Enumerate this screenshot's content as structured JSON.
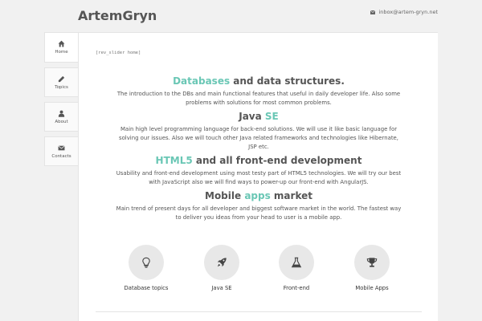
{
  "site": {
    "title": "ArtemGryn",
    "email": "inbox@artem-gryn.net"
  },
  "sidebar": {
    "items": [
      {
        "label": "Home",
        "icon": "home-icon",
        "active": true
      },
      {
        "label": "Topics",
        "icon": "pencil-icon",
        "active": false
      },
      {
        "label": "About",
        "icon": "user-icon",
        "active": false
      },
      {
        "label": "Contacts",
        "icon": "envelope-icon",
        "active": false
      }
    ]
  },
  "main": {
    "slider_shortcode": "[rev_slider home]",
    "sections": [
      {
        "title_accent": "Databases",
        "title_rest": " and data structures.",
        "text": "The introduction to the DBs and main functional features that useful in daily developer life. Also some problems with solutions for most common problems."
      },
      {
        "title_plain": "Java ",
        "title_accent": "SE",
        "text": "Main high level programming language for back-end solutions. We will use it like basic language for solving our issues. Also we will touch other Java related frameworks and technologies like Hibernate, JSP etc."
      },
      {
        "title_accent": "HTML5",
        "title_rest": " and all front-end development",
        "text": "Usability and front-end development using most testy part of HTML5 technologies. We will try our best with JavaScript also we will find ways to power-up our front-end with AngularJS."
      },
      {
        "title_plain": "Mobile ",
        "title_accent": "apps",
        "title_rest": " market",
        "text": "Main trend of present days for all developer and biggest software market in the world. The fastest way to deliver you ideas from your head to user is a mobile app."
      }
    ],
    "features": [
      {
        "label": "Database topics",
        "icon": "lightbulb-icon"
      },
      {
        "label": "Java SE",
        "icon": "rocket-icon"
      },
      {
        "label": "Front-end",
        "icon": "flask-icon"
      },
      {
        "label": "Mobile Apps",
        "icon": "trophy-icon"
      }
    ]
  },
  "colors": {
    "accent": "#6ac7b5",
    "background": "#f1f1f1",
    "panel": "#ffffff",
    "text": "#555555",
    "circle": "#e8e8e8"
  }
}
